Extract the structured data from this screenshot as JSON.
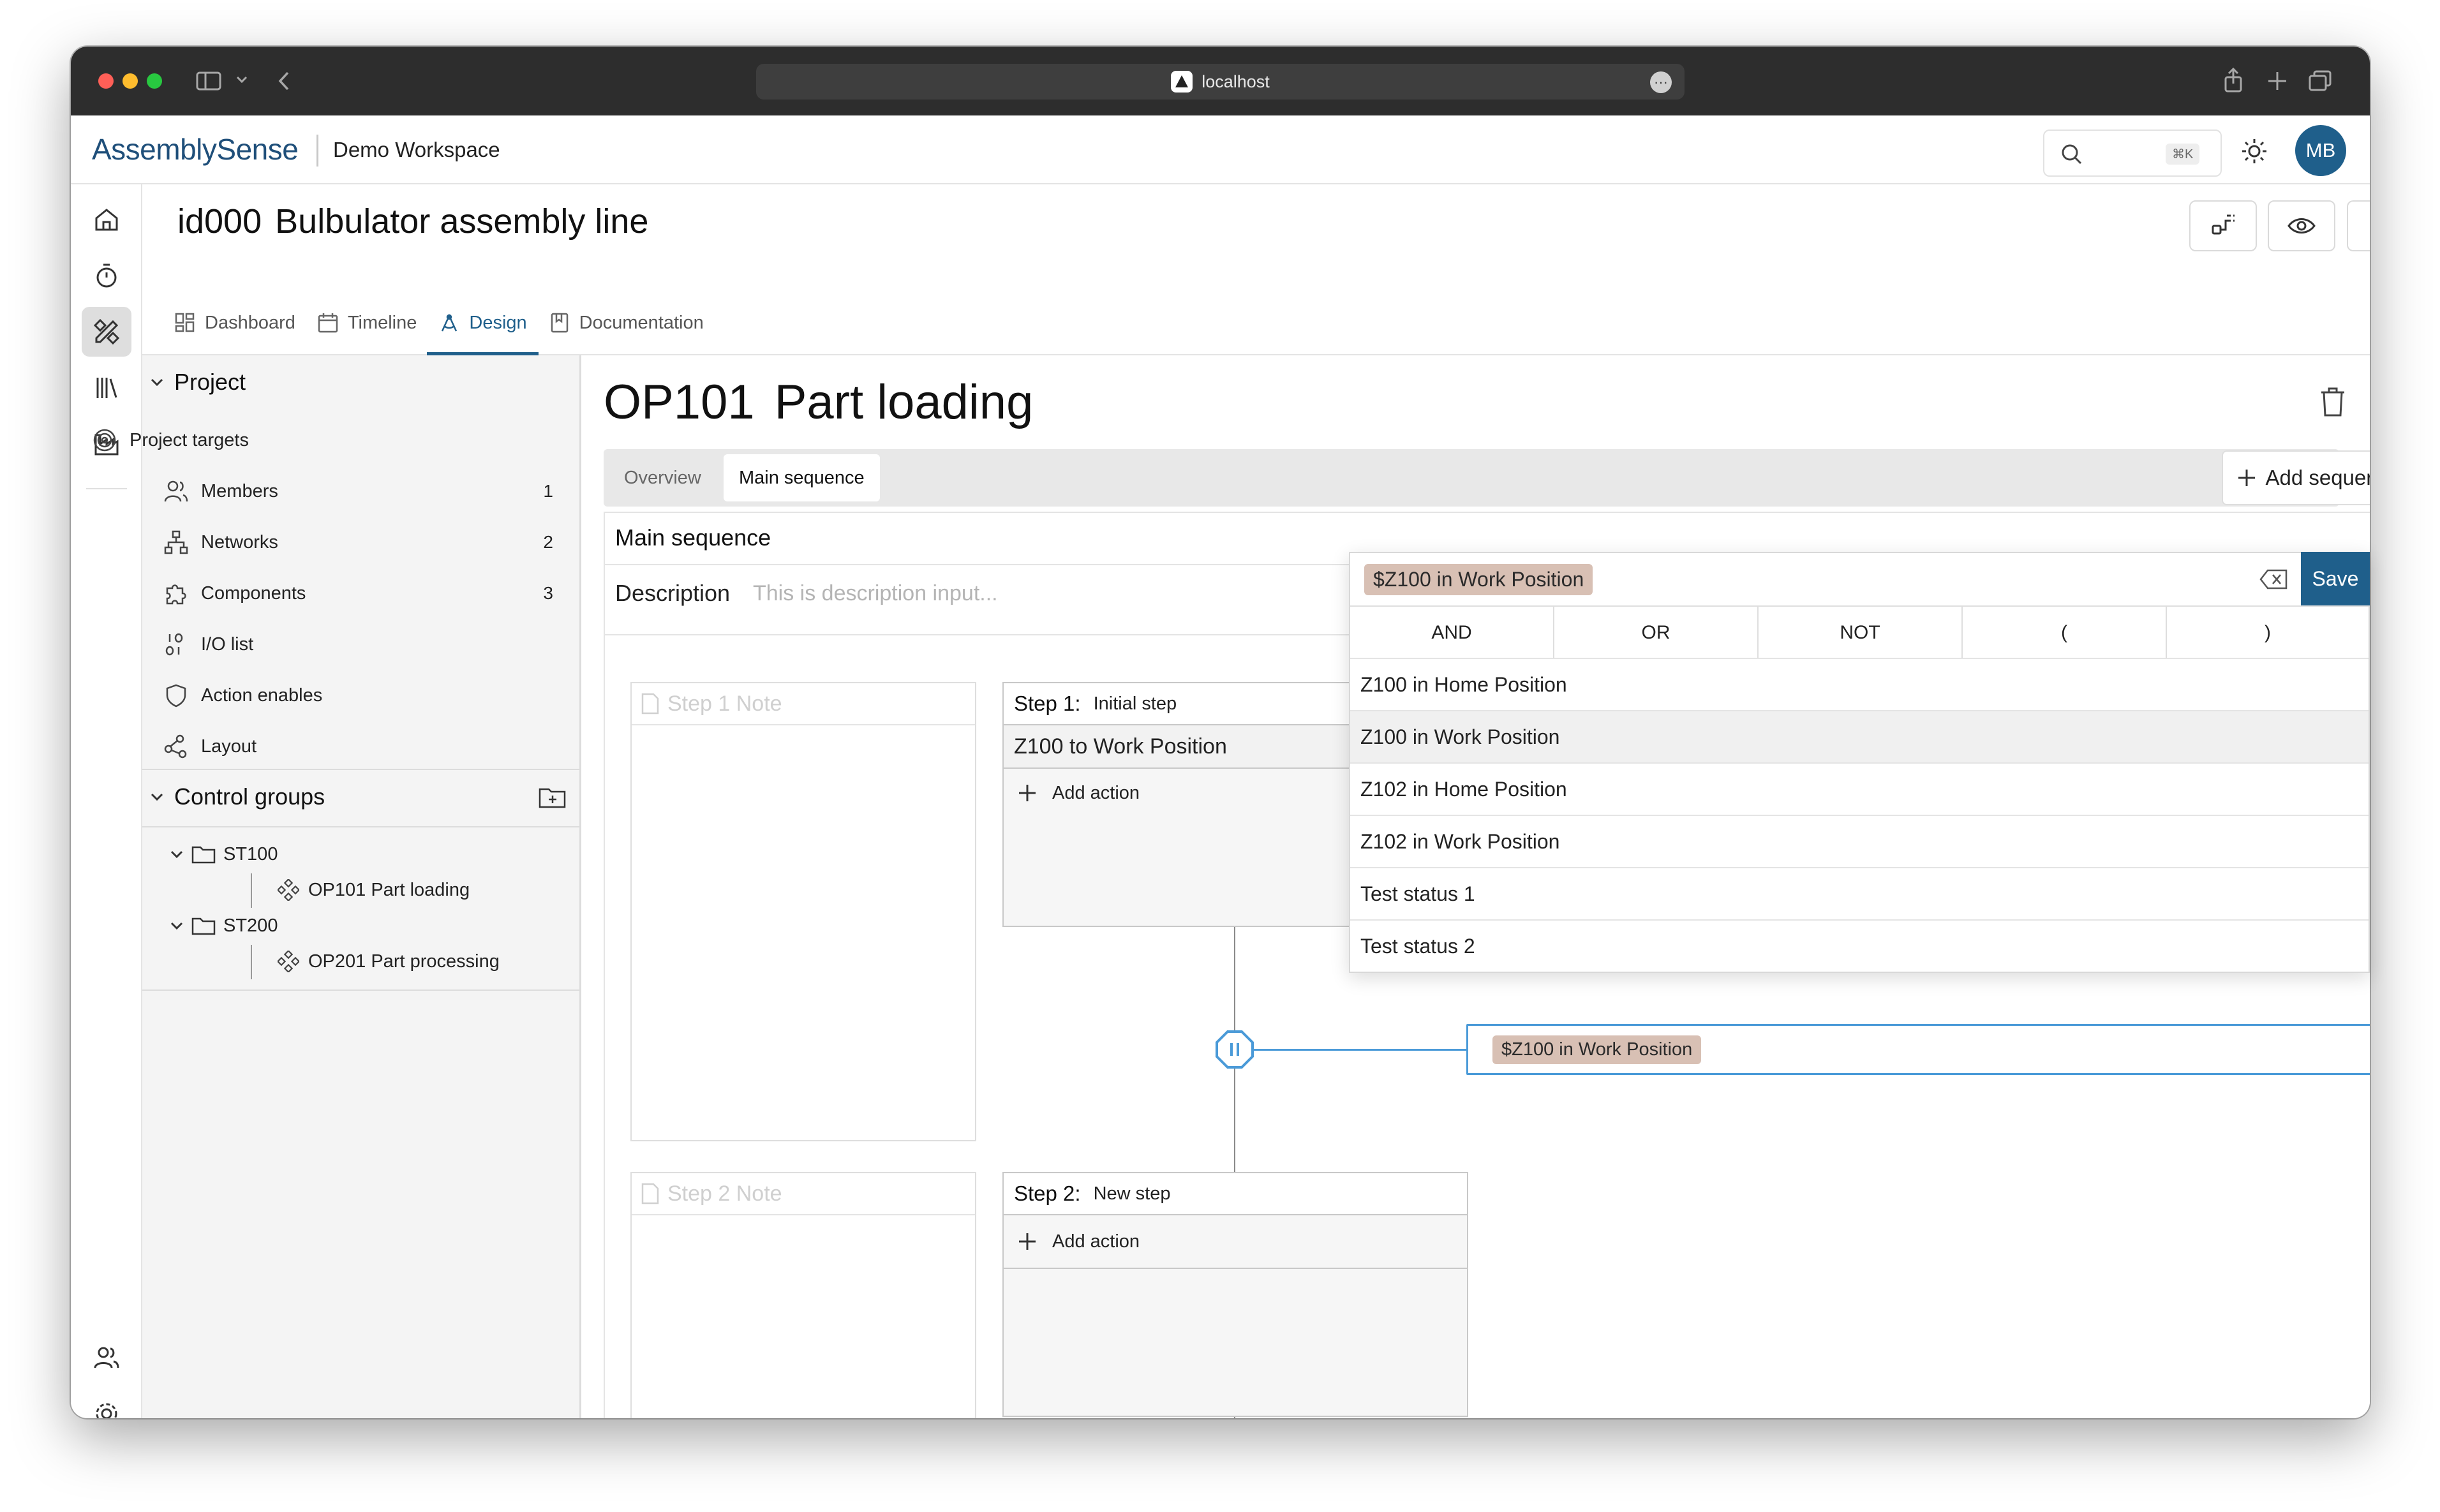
{
  "browser": {
    "url": "localhost"
  },
  "header": {
    "logo": "AssemblySense",
    "workspace": "Demo Workspace",
    "search_shortcut": "⌘K",
    "avatar": "MB"
  },
  "project": {
    "id": "id000",
    "name": "Bulbulator assembly line",
    "tabs": [
      {
        "label": "Dashboard",
        "icon": "dashboard-icon"
      },
      {
        "label": "Timeline",
        "icon": "calendar-icon"
      },
      {
        "label": "Design",
        "icon": "design-icon",
        "active": true
      },
      {
        "label": "Documentation",
        "icon": "book-icon"
      }
    ]
  },
  "sidebar": {
    "project_label": "Project",
    "items": [
      {
        "label": "Project targets",
        "icon": "target-icon",
        "count": ""
      },
      {
        "label": "Members",
        "icon": "users-icon",
        "count": "1"
      },
      {
        "label": "Networks",
        "icon": "network-icon",
        "count": "2"
      },
      {
        "label": "Components",
        "icon": "puzzle-icon",
        "count": "3"
      },
      {
        "label": "I/O list",
        "icon": "io-list-icon",
        "count": ""
      },
      {
        "label": "Action enables",
        "icon": "shield-icon",
        "count": ""
      },
      {
        "label": "Layout",
        "icon": "layout-icon",
        "count": ""
      }
    ],
    "control_groups_label": "Control groups",
    "tree": [
      {
        "label": "ST100",
        "children": [
          {
            "label": "OP101 Part loading"
          }
        ]
      },
      {
        "label": "ST200",
        "children": [
          {
            "label": "OP201 Part processing"
          }
        ]
      }
    ]
  },
  "operation": {
    "code": "OP101",
    "name": "Part loading",
    "tabs": [
      "Overview",
      "Main sequence"
    ],
    "active_tab": "Main sequence",
    "add_sequence_label": "Add sequence",
    "section_title": "Main sequence",
    "description_label": "Description",
    "description_placeholder": "This is description input...",
    "steps": [
      {
        "label": "Step 1:",
        "name": "Initial step",
        "note_placeholder": "Step 1 Note",
        "actions": [
          "Z100 to Work Position"
        ],
        "add_action_label": "Add action"
      },
      {
        "label": "Step 2:",
        "name": "New step",
        "note_placeholder": "Step 2 Note",
        "actions": [],
        "add_action_label": "Add action"
      }
    ],
    "transition_condition": "$Z100 in Work Position"
  },
  "condition_editor": {
    "expression_chip": "$Z100 in Work Position",
    "save_label": "Save",
    "operators": [
      "AND",
      "OR",
      "NOT",
      "(",
      ")"
    ],
    "options": [
      "Z100 in Home Position",
      "Z100 in Work Position",
      "Z102 in Home Position",
      "Z102 in Work Position",
      "Test status 1",
      "Test status 2"
    ],
    "highlighted_option": "Z100 in Work Position"
  },
  "colors": {
    "accent": "#1f5f8b",
    "chip": "#d8c0b4",
    "transition_line": "#4a9ad8"
  }
}
